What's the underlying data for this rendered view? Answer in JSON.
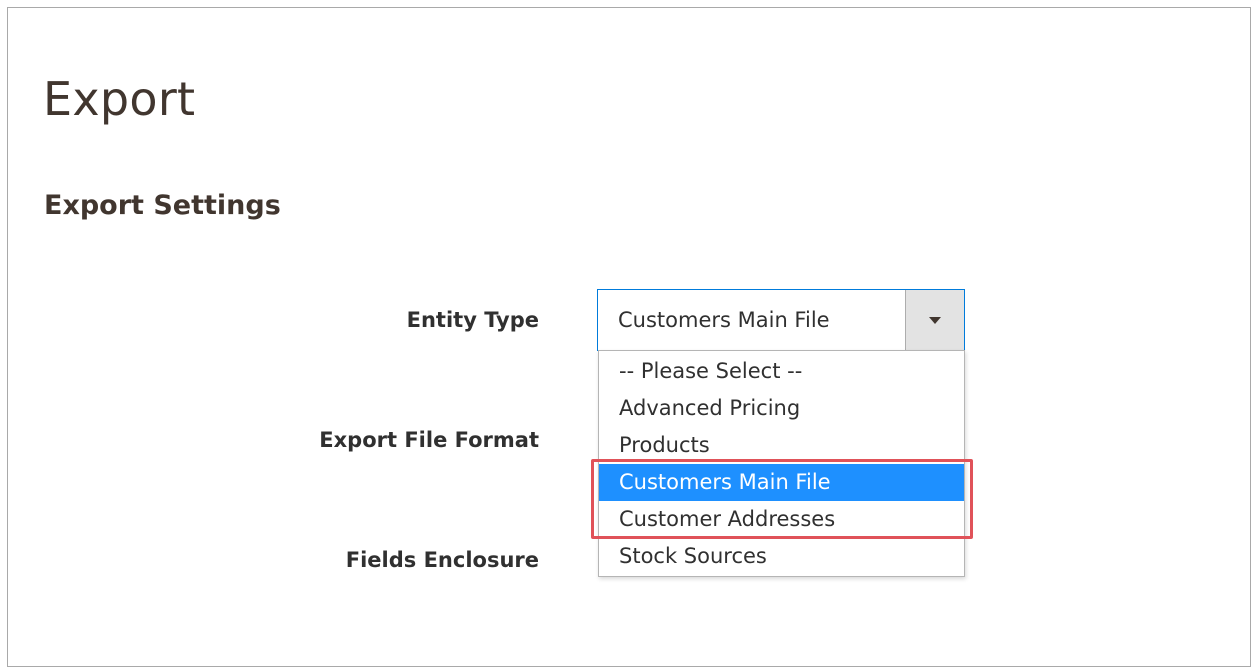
{
  "page": {
    "title": "Export"
  },
  "section": {
    "title": "Export Settings"
  },
  "fields": {
    "entity_type_label": "Entity Type",
    "export_file_format_label": "Export File Format",
    "fields_enclosure_label": "Fields Enclosure"
  },
  "entity_select": {
    "value": "Customers Main File",
    "arrow_icon": "chevron-down-icon",
    "options": [
      {
        "label": "-- Please Select --",
        "selected": false
      },
      {
        "label": "Advanced Pricing",
        "selected": false
      },
      {
        "label": "Products",
        "selected": false
      },
      {
        "label": "Customers Main File",
        "selected": true
      },
      {
        "label": "Customer Addresses",
        "selected": false
      },
      {
        "label": "Stock Sources",
        "selected": false
      }
    ]
  },
  "colors": {
    "selected_bg": "#1e90ff",
    "focus_border": "#007bdb",
    "annotation": "#e05259",
    "title_text": "#41362f"
  }
}
